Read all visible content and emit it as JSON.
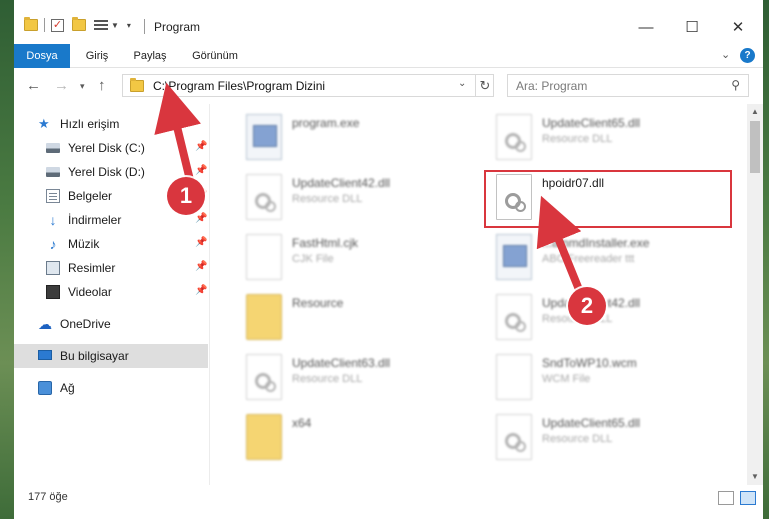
{
  "window": {
    "title": "Program",
    "minimize": "—",
    "maximize": "☐",
    "close": "✕"
  },
  "ribbon": {
    "tabs": [
      "Dosya",
      "Giriş",
      "Paylaş",
      "Görünüm"
    ],
    "active_tab": "Dosya",
    "help": "?"
  },
  "address": {
    "path": "C:\\Program Files\\Program Dizini",
    "refresh": "↻",
    "search_placeholder": "Ara: Program"
  },
  "nav": {
    "quick_access": "Hızlı erişim",
    "items": [
      {
        "label": "Yerel Disk (C:)",
        "icon": "drive-icon",
        "pinned": true
      },
      {
        "label": "Yerel Disk (D:)",
        "icon": "drive-icon",
        "pinned": true
      },
      {
        "label": "Belgeler",
        "icon": "documents-icon",
        "pinned": true
      },
      {
        "label": "İndirmeler",
        "icon": "download-icon",
        "pinned": true
      },
      {
        "label": "Müzik",
        "icon": "music-icon",
        "pinned": true
      },
      {
        "label": "Resimler",
        "icon": "pictures-icon",
        "pinned": true
      },
      {
        "label": "Videolar",
        "icon": "videos-icon",
        "pinned": true
      }
    ],
    "onedrive": "OneDrive",
    "this_pc": "Bu bilgisayar",
    "network": "Ağ"
  },
  "files": [
    {
      "name": "program.exe",
      "type": "",
      "icon": "exe-icon"
    },
    {
      "name": "UpdateClient65.dll",
      "type": "Resource DLL",
      "icon": "dll-icon"
    },
    {
      "name": "UpdateClient42.dll",
      "type": "Resource DLL",
      "icon": "dll-icon"
    },
    {
      "name": "hpoidr07.dll",
      "type": "",
      "icon": "dll-icon"
    },
    {
      "name": "FastHtml.cjk",
      "type": "CJK File",
      "icon": "file-icon"
    },
    {
      "name": "...ammdInstaller.exe",
      "type": "ABC Freereader ttt",
      "icon": "exe-icon"
    },
    {
      "name": "Resource",
      "type": "",
      "icon": "folder-icon"
    },
    {
      "name": "UpdateClient42.dll",
      "type": "Resource DLL",
      "icon": "dll-icon"
    },
    {
      "name": "UpdateClient63.dll",
      "type": "Resource DLL",
      "icon": "dll-icon"
    },
    {
      "name": "SndToWP10.wcm",
      "type": "WCM File",
      "icon": "file-icon"
    },
    {
      "name": "x64",
      "type": "",
      "icon": "folder-icon"
    },
    {
      "name": "UpdateClient65.dll",
      "type": "Resource DLL",
      "icon": "dll-icon"
    }
  ],
  "status": {
    "count": "177 öğe"
  },
  "annotations": {
    "step1": "1",
    "step2": "2",
    "color": "#d9363e"
  }
}
